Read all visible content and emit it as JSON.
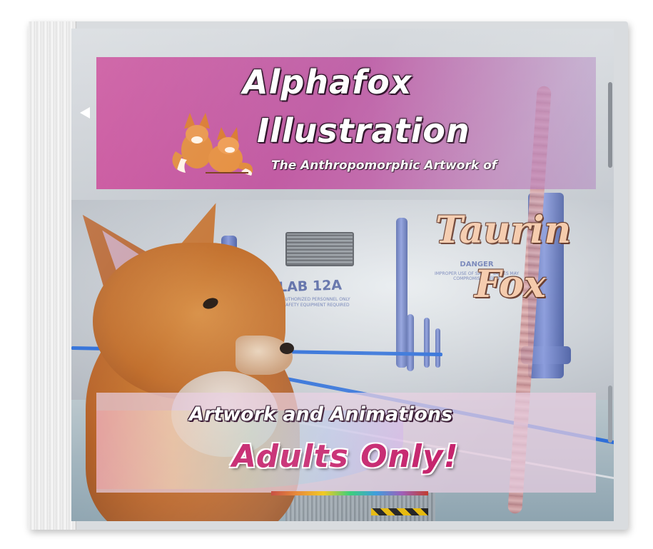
{
  "cover": {
    "title_line1": "Alphafox",
    "title_line2": "Illustration",
    "tagline": "The Anthropomorphic Artwork of",
    "artist_line1": "Taurin",
    "artist_line2": "Fox",
    "subtitle": "Artwork and Animations",
    "warning": "Adults Only!"
  },
  "scene": {
    "lab_sign": "LAB 12A",
    "lab_sign_sub": "AUTHORIZED PERSONNEL ONLY SAFETY EQUIPMENT REQUIRED",
    "danger_sign": "DANGER",
    "danger_sign_sub": "IMPROPER USE OF SAFETY VALVES MAY COMPROMISE SAFETY"
  },
  "colors": {
    "banner": "#c74696",
    "title_text": "#ffffff",
    "artist_text": "#f4c8a8",
    "warning_text": "#c41f6a",
    "rail": "#2f6fd8",
    "pipes": "#6f82c6"
  },
  "icons": {
    "logo": "two-foxes-logo-icon"
  }
}
